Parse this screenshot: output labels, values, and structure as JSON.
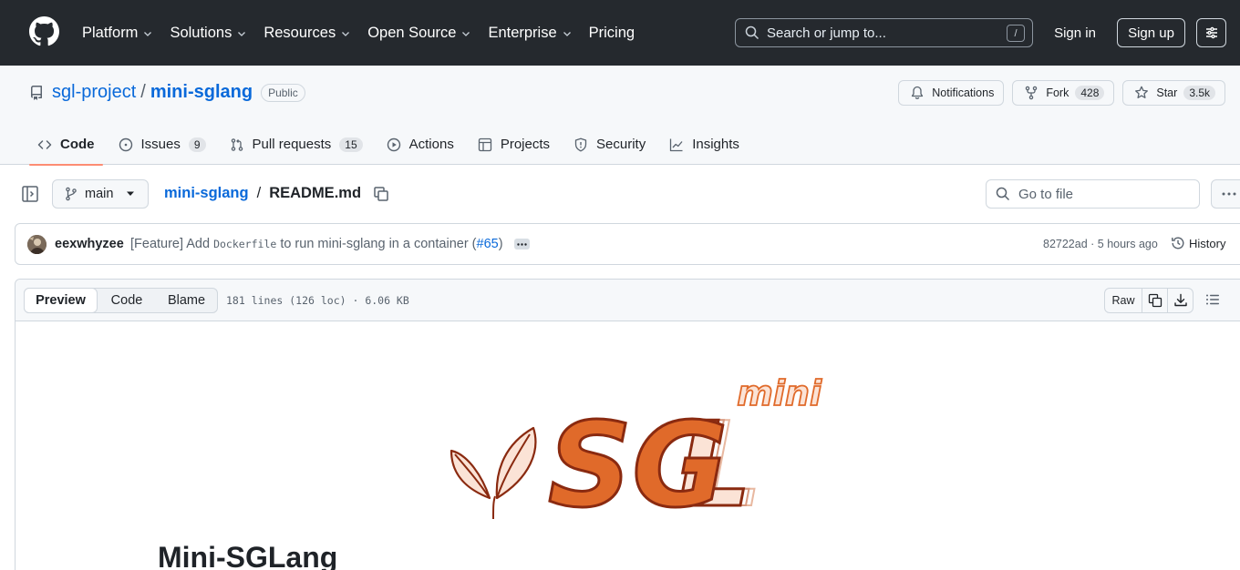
{
  "header": {
    "nav": [
      {
        "label": "Platform"
      },
      {
        "label": "Solutions"
      },
      {
        "label": "Resources"
      },
      {
        "label": "Open Source"
      },
      {
        "label": "Enterprise"
      },
      {
        "label": "Pricing"
      }
    ],
    "search_placeholder": "Search or jump to...",
    "search_shortcut": "/",
    "sign_in": "Sign in",
    "sign_up": "Sign up"
  },
  "repo": {
    "owner": "sgl-project",
    "separator": "/",
    "name": "mini-sglang",
    "visibility": "Public",
    "notifications_label": "Notifications",
    "fork_label": "Fork",
    "fork_count": "428",
    "star_label": "Star",
    "star_count": "3.5k"
  },
  "tabs": [
    {
      "label": "Code",
      "icon": "code-icon",
      "selected": true
    },
    {
      "label": "Issues",
      "icon": "issue-opened-icon",
      "count": "9"
    },
    {
      "label": "Pull requests",
      "icon": "git-pull-request-icon",
      "count": "15"
    },
    {
      "label": "Actions",
      "icon": "play-icon"
    },
    {
      "label": "Projects",
      "icon": "table-icon"
    },
    {
      "label": "Security",
      "icon": "shield-icon"
    },
    {
      "label": "Insights",
      "icon": "graph-icon"
    }
  ],
  "file_nav": {
    "branch": "main",
    "breadcrumb_repo": "mini-sglang",
    "breadcrumb_sep": "/",
    "breadcrumb_file": "README.md",
    "goto_placeholder": "Go to file"
  },
  "commit": {
    "author": "eexwhyzee",
    "message_prefix": "[Feature] Add",
    "message_code": "Dockerfile",
    "message_suffix": "to run mini-sglang in a container (",
    "pr": "#65",
    "message_end": ")",
    "sha": "82722ad",
    "time_sep": " · ",
    "time": "5 hours ago",
    "history": "History"
  },
  "file": {
    "views": [
      {
        "label": "Preview",
        "active": true
      },
      {
        "label": "Code"
      },
      {
        "label": "Blame"
      }
    ],
    "info": "181 lines (126 loc) · 6.06 KB",
    "raw": "Raw"
  },
  "readme": {
    "logo_word_small": "mini",
    "logo_word_big_1": "SG",
    "logo_word_big_2": "L",
    "title": "Mini-SGLang"
  },
  "colors": {
    "header_bg": "#25292e",
    "link": "#0969da",
    "tab_underline": "#fd8c73",
    "logo_orange": "#e06a2a",
    "logo_dark": "#8a2a10"
  }
}
